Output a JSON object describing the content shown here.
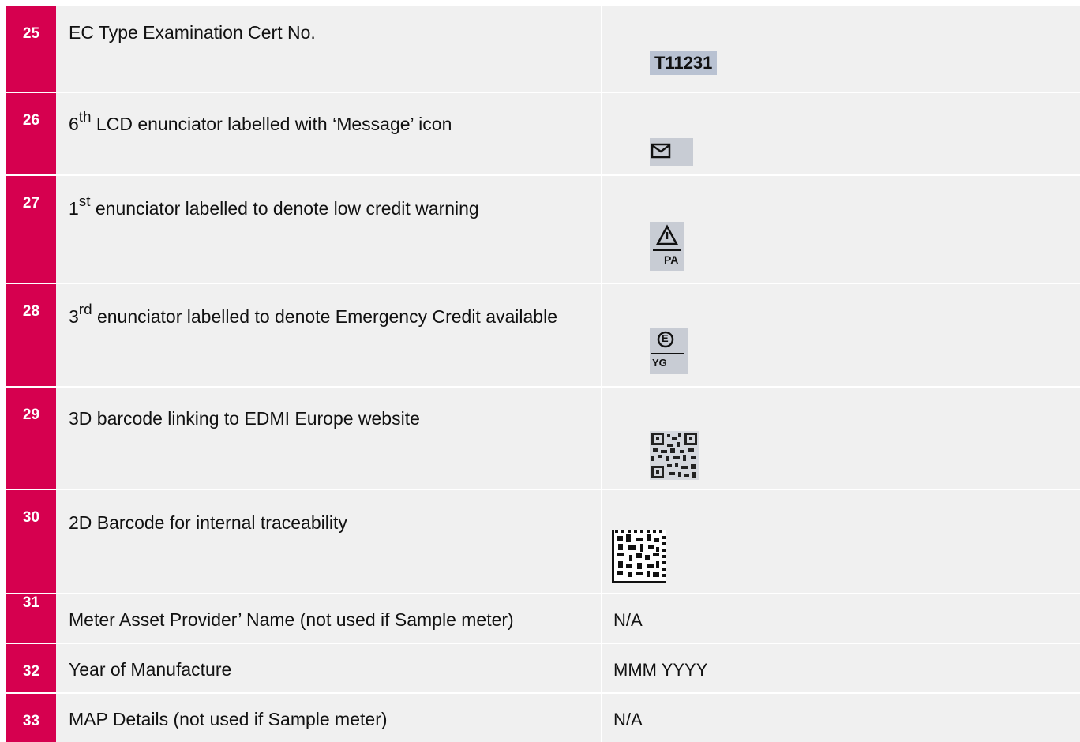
{
  "rows": [
    {
      "num": "25",
      "desc": "EC Type Examination Cert No.",
      "value": "T11231"
    },
    {
      "num": "26",
      "desc_pre": "6",
      "desc_sup": "th",
      "desc_post": " LCD enunciator labelled with ‘Message’ icon",
      "icon": "envelope-icon"
    },
    {
      "num": "27",
      "desc_pre": "1",
      "desc_sup": "st",
      "desc_post": " enunciator labelled to denote low credit warning",
      "icon": "warning-triangle-icon",
      "icon_caption": "PA"
    },
    {
      "num": "28",
      "desc_pre": "3",
      "desc_sup": "rd",
      "desc_post": " enunciator labelled to denote Emergency Credit available",
      "icon": "emergency-credit-icon",
      "icon_caption": "YG",
      "icon_letter": "E"
    },
    {
      "num": "29",
      "desc": "3D barcode linking to EDMI Europe website",
      "icon": "qr-code-icon"
    },
    {
      "num": "30",
      "desc": "2D Barcode for internal traceability",
      "icon": "datamatrix-icon"
    },
    {
      "num": "31",
      "desc": "Meter Asset Provider’ Name (not used if Sample meter)",
      "value": "N/A"
    },
    {
      "num": "32",
      "desc": "Year of Manufacture",
      "value": "MMM YYYY"
    },
    {
      "num": "33",
      "desc": "MAP Details (not used if Sample meter)",
      "value": "N/A"
    }
  ]
}
